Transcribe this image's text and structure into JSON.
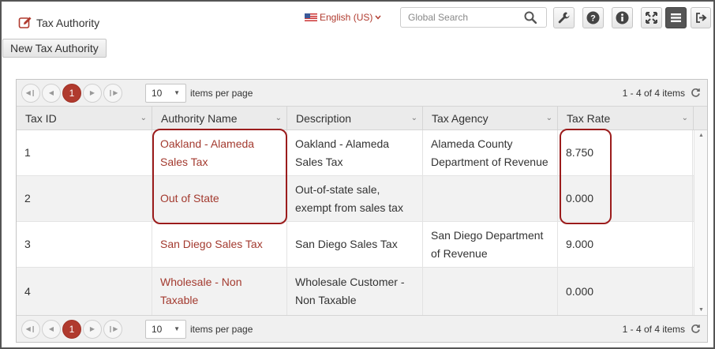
{
  "header": {
    "title": "Tax Authority",
    "new_button_label": "New Tax Authority",
    "language": "English (US)",
    "search_placeholder": "Global Search"
  },
  "toolbar": {
    "icons": [
      "wrench-icon",
      "help-icon",
      "info-icon",
      "fullscreen-icon",
      "menu-icon",
      "logout-icon"
    ]
  },
  "pager": {
    "current_page": "1",
    "page_size": "10",
    "page_size_label": "items per page",
    "info": "1 - 4 of 4 items"
  },
  "table": {
    "columns": [
      "Tax ID",
      "Authority Name",
      "Description",
      "Tax Agency",
      "Tax Rate"
    ],
    "rows": [
      {
        "tax_id": "1",
        "authority_name": "Oakland - Alameda Sales Tax",
        "description": "Oakland - Alameda Sales Tax",
        "tax_agency": "Alameda County Department of Revenue",
        "tax_rate": "8.750"
      },
      {
        "tax_id": "2",
        "authority_name": "Out of State",
        "description": "Out-of-state sale, exempt from sales tax",
        "tax_agency": "",
        "tax_rate": "0.000"
      },
      {
        "tax_id": "3",
        "authority_name": "San Diego Sales Tax",
        "description": "San Diego Sales Tax",
        "tax_agency": "San Diego Department of Revenue",
        "tax_rate": "9.000"
      },
      {
        "tax_id": "4",
        "authority_name": "Wholesale - Non Taxable",
        "description": "Wholesale Customer - Non Taxable",
        "tax_agency": "",
        "tax_rate": "0.000"
      }
    ]
  },
  "colors": {
    "accent": "#b03a2e",
    "highlight": "#9b1c1c"
  }
}
